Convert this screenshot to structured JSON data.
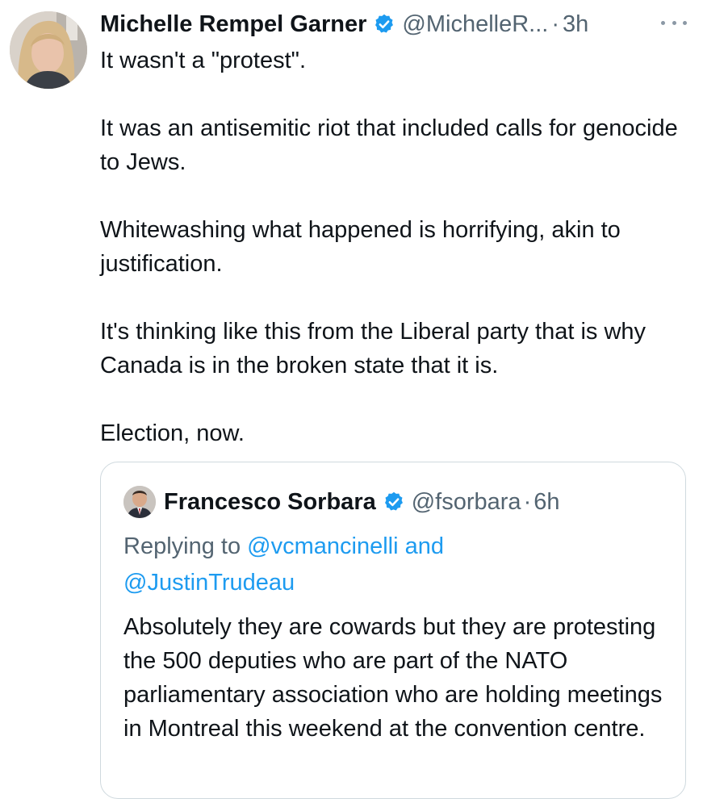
{
  "tweet": {
    "author": {
      "name": "Michelle Rempel Garner",
      "handle": "@MichelleR...",
      "separator": "·",
      "time": "3h"
    },
    "paragraphs": [
      "It wasn't a \"protest\".",
      "It was an antisemitic riot that included calls for genocide to Jews.",
      "Whitewashing what happened is horrifying, akin to justification.",
      "It's thinking like this from the Liberal party that is why Canada is in the broken state that it is.",
      "Election, now."
    ]
  },
  "quoted_tweet": {
    "author": {
      "name": "Francesco Sorbara",
      "handle": "@fsorbara",
      "separator": "·",
      "time": "6h"
    },
    "replying_prefix": "Replying to ",
    "replying_user_1": "@vcmancinelli",
    "replying_and": " and",
    "replying_user_2": "@JustinTrudeau",
    "text": "Absolutely they are cowards but they are protesting the 500 deputies who are part of the NATO parliamentary association who are holding meetings in Montreal this weekend at the convention centre."
  },
  "icons": {
    "verified": "verified-badge-icon",
    "more": "more-horizontal-icon"
  },
  "colors": {
    "text_primary": "#0f1419",
    "text_secondary": "#536471",
    "link": "#1d9bf0",
    "verified": "#1d9bf0",
    "border": "#cfd9de"
  }
}
